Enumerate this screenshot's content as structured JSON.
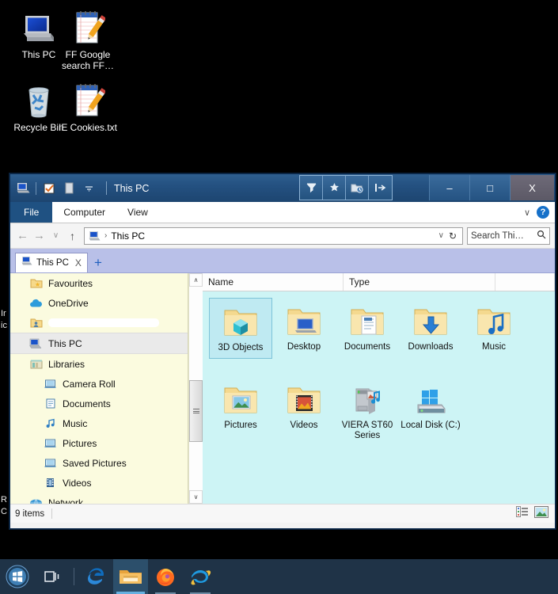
{
  "desktop": {
    "icons": [
      {
        "label": "This PC",
        "icon": "computer-icon"
      },
      {
        "label": "FF Google search FF…",
        "icon": "text-file-icon"
      },
      {
        "label": "Recycle Bin",
        "icon": "recycle-bin-icon"
      },
      {
        "label": "IE Cookies.txt",
        "icon": "text-file-icon"
      }
    ],
    "clipped_labels": [
      "Ir",
      "ic",
      "R",
      "C"
    ]
  },
  "window": {
    "title": "This PC",
    "quick_access": [
      {
        "name": "this-pc-icon",
        "label": "This PC"
      },
      {
        "name": "properties-icon",
        "label": "Properties"
      },
      {
        "name": "new-folder-icon",
        "label": "New folder"
      },
      {
        "name": "customize-qat-icon",
        "label": "Customize Quick Access Toolbar"
      }
    ],
    "tool_buttons": [
      {
        "name": "filter-icon",
        "label": "Filter"
      },
      {
        "name": "pin-icon",
        "label": "Pin"
      },
      {
        "name": "folder-history-icon",
        "label": "Folder history"
      },
      {
        "name": "go-to-icon",
        "label": "Go to"
      }
    ],
    "caption": {
      "minimize": "–",
      "maximize": "□",
      "close": "X"
    },
    "ribbon": {
      "tabs": [
        "File",
        "Computer",
        "View"
      ],
      "collapse_label": "∨",
      "help_label": "?"
    },
    "address": {
      "back": "←",
      "forward": "→",
      "recent": "∨",
      "up": "↑",
      "separator": "›",
      "path": "This PC",
      "dropdown": "∨",
      "refresh": "↻"
    },
    "search": {
      "value": "Search Thi…",
      "placeholder": "Search This PC",
      "icon": "search-icon"
    },
    "tabs": {
      "items": [
        {
          "label": "This PC",
          "close": "X"
        }
      ],
      "new_tab": "+"
    }
  },
  "nav_pane": {
    "items": [
      {
        "label": "Favourites",
        "icon": "favourites-folder-icon",
        "level": 0,
        "selected": false
      },
      {
        "label": "OneDrive",
        "icon": "onedrive-icon",
        "level": 0,
        "selected": false
      },
      {
        "label": "",
        "icon": "user-folder-icon",
        "level": 0,
        "selected": false,
        "redacted": true
      },
      {
        "label": "This PC",
        "icon": "this-pc-icon",
        "level": 0,
        "selected": true
      },
      {
        "label": "Libraries",
        "icon": "libraries-icon",
        "level": 0,
        "selected": false
      },
      {
        "label": "Camera Roll",
        "icon": "library-icon",
        "level": 1,
        "selected": false
      },
      {
        "label": "Documents",
        "icon": "documents-library-icon",
        "level": 1,
        "selected": false
      },
      {
        "label": "Music",
        "icon": "music-library-icon",
        "level": 1,
        "selected": false
      },
      {
        "label": "Pictures",
        "icon": "pictures-library-icon",
        "level": 1,
        "selected": false
      },
      {
        "label": "Saved Pictures",
        "icon": "library-icon",
        "level": 1,
        "selected": false
      },
      {
        "label": "Videos",
        "icon": "videos-library-icon",
        "level": 1,
        "selected": false
      },
      {
        "label": "Network",
        "icon": "network-icon",
        "level": 0,
        "selected": false
      }
    ],
    "scroll": {
      "up": "∧",
      "down": "∨"
    }
  },
  "content": {
    "columns": [
      "Name",
      "Type",
      ""
    ],
    "items": [
      {
        "label": "3D Objects",
        "icon": "folder-3d-objects-icon",
        "selected": true
      },
      {
        "label": "Desktop",
        "icon": "folder-desktop-icon",
        "selected": false
      },
      {
        "label": "Documents",
        "icon": "folder-documents-icon",
        "selected": false
      },
      {
        "label": "Downloads",
        "icon": "folder-downloads-icon",
        "selected": false
      },
      {
        "label": "Music",
        "icon": "folder-music-icon",
        "selected": false
      },
      {
        "label": "Pictures",
        "icon": "folder-pictures-icon",
        "selected": false
      },
      {
        "label": "Videos",
        "icon": "folder-videos-icon",
        "selected": false
      },
      {
        "label": "VIERA ST60 Series",
        "icon": "media-device-icon",
        "selected": false
      },
      {
        "label": "Local Disk (C:)",
        "icon": "local-disk-icon",
        "selected": false
      }
    ]
  },
  "status": {
    "item_count": "9 items",
    "views": [
      {
        "name": "details-view-button",
        "label": "Details view"
      },
      {
        "name": "large-icons-view-button",
        "label": "Large icons view"
      }
    ]
  },
  "taskbar": {
    "items": [
      {
        "name": "start-button",
        "label": "Start",
        "state": "idle"
      },
      {
        "name": "task-view-button",
        "label": "Task View",
        "state": "idle"
      },
      {
        "name": "taskbar-separator",
        "label": "",
        "state": "sep"
      },
      {
        "name": "edge-taskbar-button",
        "label": "Microsoft Edge",
        "state": "idle"
      },
      {
        "name": "file-explorer-taskbar-button",
        "label": "File Explorer",
        "state": "active"
      },
      {
        "name": "firefox-taskbar-button",
        "label": "Mozilla Firefox",
        "state": "running"
      },
      {
        "name": "internet-explorer-taskbar-button",
        "label": "Internet Explorer",
        "state": "running"
      }
    ]
  },
  "colors": {
    "title_bar": "#245181",
    "nav_pane_bg": "#fbfbdf",
    "content_bg": "#cdf4f5",
    "tab_strip": "#b9c0e8",
    "taskbar": "#1f3347",
    "accent": "#1570c9"
  }
}
